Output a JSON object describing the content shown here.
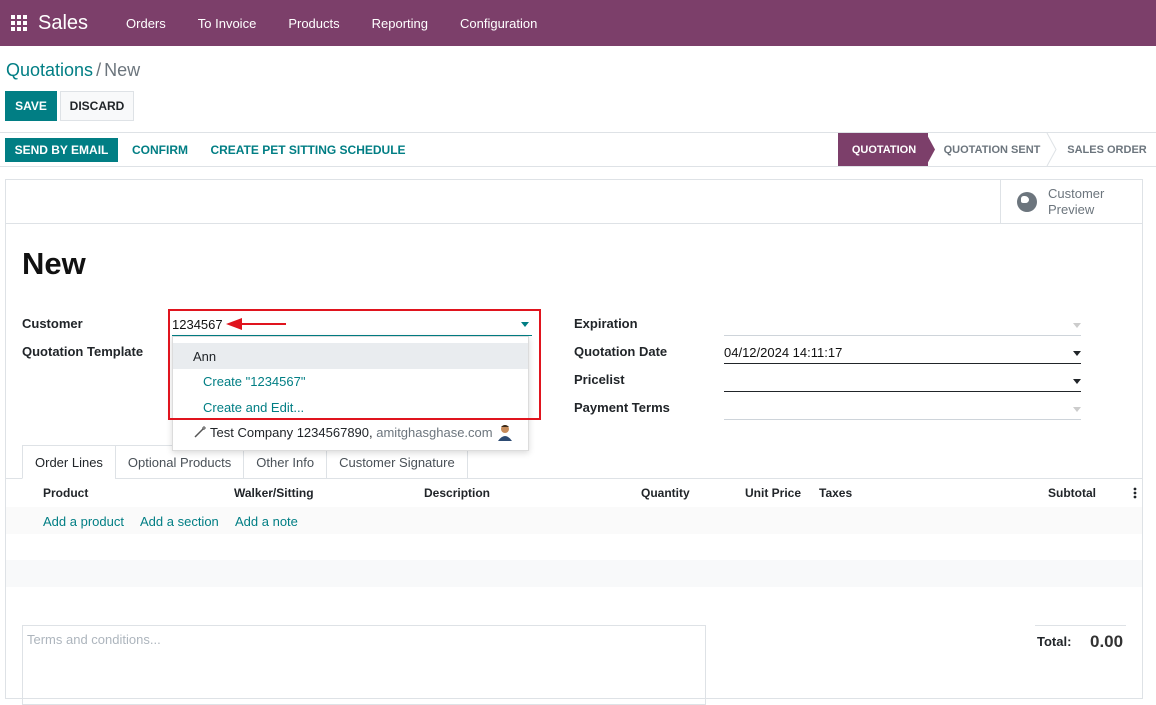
{
  "navbar": {
    "app_name": "Sales",
    "menu": [
      "Orders",
      "To Invoice",
      "Products",
      "Reporting",
      "Configuration"
    ],
    "bg_color": "#7c3f6a"
  },
  "breadcrumb": {
    "parent": "Quotations",
    "separator": "/",
    "current": "New"
  },
  "actions": {
    "save": "SAVE",
    "discard": "DISCARD"
  },
  "statusbar": {
    "send_email": "SEND BY EMAIL",
    "confirm": "CONFIRM",
    "pet_schedule": "CREATE PET SITTING SCHEDULE",
    "stages": [
      "QUOTATION",
      "QUOTATION SENT",
      "SALES ORDER"
    ],
    "active_stage": "QUOTATION"
  },
  "smart_button": {
    "icon": "globe-icon",
    "line1": "Customer",
    "line2": "Preview"
  },
  "form": {
    "title": "New",
    "customer_label": "Customer",
    "customer_value": "1234567",
    "template_label": "Quotation Template",
    "expiration_label": "Expiration",
    "quotation_date_label": "Quotation Date",
    "quotation_date_value": "04/12/2024 14:11:17",
    "pricelist_label": "Pricelist",
    "payment_terms_label": "Payment Terms"
  },
  "autocomplete": {
    "items": [
      "Ann",
      "Create \"1234567\"",
      "Create and Edit..."
    ],
    "partial_row": {
      "name": "Test Company 1234567890,",
      "email": "amitghasghase.com"
    }
  },
  "tabs": [
    "Order Lines",
    "Optional Products",
    "Other Info",
    "Customer Signature"
  ],
  "table": {
    "headers": [
      "Product",
      "Walker/Sitting",
      "Description",
      "Quantity",
      "Unit Price",
      "Taxes",
      "Subtotal"
    ],
    "add_links": [
      "Add a product",
      "Add a section",
      "Add a note"
    ]
  },
  "terms_placeholder": "Terms and conditions...",
  "totals": {
    "label": "Total:",
    "value": "0.00"
  },
  "colors": {
    "primary": "#017e84",
    "brand": "#7c3f6a",
    "highlight": "#e0141e"
  }
}
